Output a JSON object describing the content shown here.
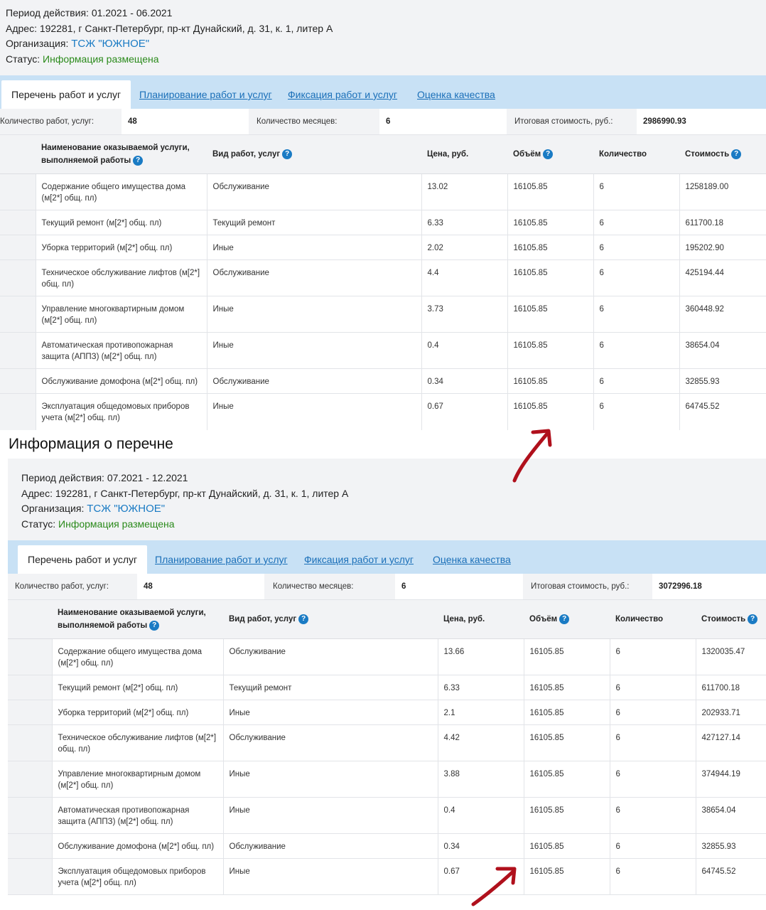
{
  "panel1": {
    "period_label": "Период действия:",
    "period_value": "01.2021 - 06.2021",
    "address_label": "Адрес:",
    "address_value": "192281, г Санкт-Петербург, пр-кт Дунайский, д. 31, к. 1, литер А",
    "org_label": "Организация:",
    "org_value": "ТСЖ \"ЮЖНОЕ\"",
    "status_label": "Статус:",
    "status_value": "Информация размещена",
    "tabs": [
      "Перечень работ и услуг",
      "Планирование работ и услуг",
      "Фиксация работ и услуг",
      "Оценка качества"
    ],
    "summary": {
      "count_label": "Количество работ, услуг:",
      "count_value": "48",
      "months_label": "Количество месяцев:",
      "months_value": "6",
      "total_label": "Итоговая стоимость, руб.:",
      "total_value": "2986990.93"
    },
    "rows": [
      {
        "name": "Содержание общего имущества дома (м[2*] общ. пл)",
        "type": "Обслуживание",
        "price": "13.02",
        "volume": "16105.85",
        "qty": "6",
        "cost": "1258189.00"
      },
      {
        "name": "Текущий ремонт (м[2*] общ. пл)",
        "type": "Текущий ремонт",
        "price": "6.33",
        "volume": "16105.85",
        "qty": "6",
        "cost": "611700.18"
      },
      {
        "name": "Уборка территорий (м[2*] общ. пл)",
        "type": "Иные",
        "price": "2.02",
        "volume": "16105.85",
        "qty": "6",
        "cost": "195202.90"
      },
      {
        "name": "Техническое обслуживание лифтов (м[2*] общ. пл)",
        "type": "Обслуживание",
        "price": "4.4",
        "volume": "16105.85",
        "qty": "6",
        "cost": "425194.44"
      },
      {
        "name": "Управление многоквартирным домом (м[2*] общ. пл)",
        "type": "Иные",
        "price": "3.73",
        "volume": "16105.85",
        "qty": "6",
        "cost": "360448.92"
      },
      {
        "name": "Автоматическая противопожарная защита (АППЗ) (м[2*] общ. пл)",
        "type": "Иные",
        "price": "0.4",
        "volume": "16105.85",
        "qty": "6",
        "cost": "38654.04"
      },
      {
        "name": "Обслуживание домофона (м[2*] общ. пл)",
        "type": "Обслуживание",
        "price": "0.34",
        "volume": "16105.85",
        "qty": "6",
        "cost": "32855.93"
      },
      {
        "name": "Эксплуатация общедомовых приборов учета (м[2*] общ. пл)",
        "type": "Иные",
        "price": "0.67",
        "volume": "16105.85",
        "qty": "6",
        "cost": "64745.52"
      }
    ]
  },
  "columns": {
    "name": "Наименование оказываемой услуги, выполняемой работы",
    "type": "Вид работ, услуг",
    "price": "Цена, руб.",
    "volume": "Объём",
    "qty": "Количество",
    "cost": "Стоимость"
  },
  "section_heading": "Информация о перечне",
  "panel2": {
    "period_label": "Период действия:",
    "period_value": "07.2021 - 12.2021",
    "address_label": "Адрес:",
    "address_value": "192281, г Санкт-Петербург, пр-кт Дунайский, д. 31, к. 1, литер А",
    "org_label": "Организация:",
    "org_value": "ТСЖ \"ЮЖНОЕ\"",
    "status_label": "Статус:",
    "status_value": "Информация размещена",
    "tabs": [
      "Перечень работ и услуг",
      "Планирование работ и услуг",
      "Фиксация работ и услуг",
      "Оценка качества"
    ],
    "summary": {
      "count_label": "Количество работ, услуг:",
      "count_value": "48",
      "months_label": "Количество месяцев:",
      "months_value": "6",
      "total_label": "Итоговая стоимость, руб.:",
      "total_value": "3072996.18"
    },
    "rows": [
      {
        "name": "Содержание общего имущества дома (м[2*] общ. пл)",
        "type": "Обслуживание",
        "price": "13.66",
        "volume": "16105.85",
        "qty": "6",
        "cost": "1320035.47"
      },
      {
        "name": "Текущий ремонт (м[2*] общ. пл)",
        "type": "Текущий ремонт",
        "price": "6.33",
        "volume": "16105.85",
        "qty": "6",
        "cost": "611700.18"
      },
      {
        "name": "Уборка территорий (м[2*] общ. пл)",
        "type": "Иные",
        "price": "2.1",
        "volume": "16105.85",
        "qty": "6",
        "cost": "202933.71"
      },
      {
        "name": "Техническое обслуживание лифтов (м[2*] общ. пл)",
        "type": "Обслуживание",
        "price": "4.42",
        "volume": "16105.85",
        "qty": "6",
        "cost": "427127.14"
      },
      {
        "name": "Управление многоквартирным домом (м[2*] общ. пл)",
        "type": "Иные",
        "price": "3.88",
        "volume": "16105.85",
        "qty": "6",
        "cost": "374944.19"
      },
      {
        "name": "Автоматическая противопожарная защита (АППЗ) (м[2*] общ. пл)",
        "type": "Иные",
        "price": "0.4",
        "volume": "16105.85",
        "qty": "6",
        "cost": "38654.04"
      },
      {
        "name": "Обслуживание домофона (м[2*] общ. пл)",
        "type": "Обслуживание",
        "price": "0.34",
        "volume": "16105.85",
        "qty": "6",
        "cost": "32855.93"
      },
      {
        "name": "Эксплуатация общедомовых приборов учета (м[2*] общ. пл)",
        "type": "Иные",
        "price": "0.67",
        "volume": "16105.85",
        "qty": "6",
        "cost": "64745.52"
      }
    ]
  },
  "icons": {
    "help": "help-icon",
    "annotation": "red-arrow-icon"
  },
  "colors": {
    "link": "#1a6fb8",
    "status": "#2a8a1a",
    "tabbar": "#c8e1f5",
    "arrow": "#b0101c"
  }
}
